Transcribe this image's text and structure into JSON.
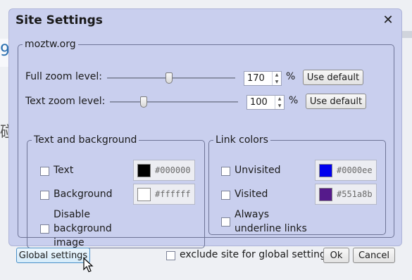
{
  "dialog": {
    "title": "Site Settings",
    "close_glyph": "✕"
  },
  "site": {
    "legend": "moztw.org",
    "full_zoom": {
      "label": "Full zoom level:",
      "value": "170",
      "unit": "%",
      "button": "Use default",
      "slider_level": 0.48
    },
    "text_zoom": {
      "label": "Text zoom level:",
      "value": "100",
      "unit": "%",
      "button": "Use default",
      "slider_level": 0.25
    }
  },
  "text_bg": {
    "legend": "Text and background",
    "text_label": "Text",
    "text_color": "#000000",
    "background_label": "Background",
    "background_color": "#ffffff",
    "disable_bg_line1": "Disable",
    "disable_bg_line2": "background",
    "disable_bg_line3": "image"
  },
  "links": {
    "legend": "Link colors",
    "unvisited_label": "Unvisited",
    "unvisited_color": "#0000ee",
    "visited_label": "Visited",
    "visited_color": "#551a8b",
    "underline_line1": "Always",
    "underline_line2": "underline links"
  },
  "footer": {
    "global_button": "Global settings",
    "exclude_label": "exclude site for global settings",
    "ok_button": "Ok",
    "cancel_button": "Cancel"
  },
  "icons": [
    "close-icon",
    "checkbox-icon",
    "spin-arrow-icon",
    "mouse-cursor-icon"
  ]
}
